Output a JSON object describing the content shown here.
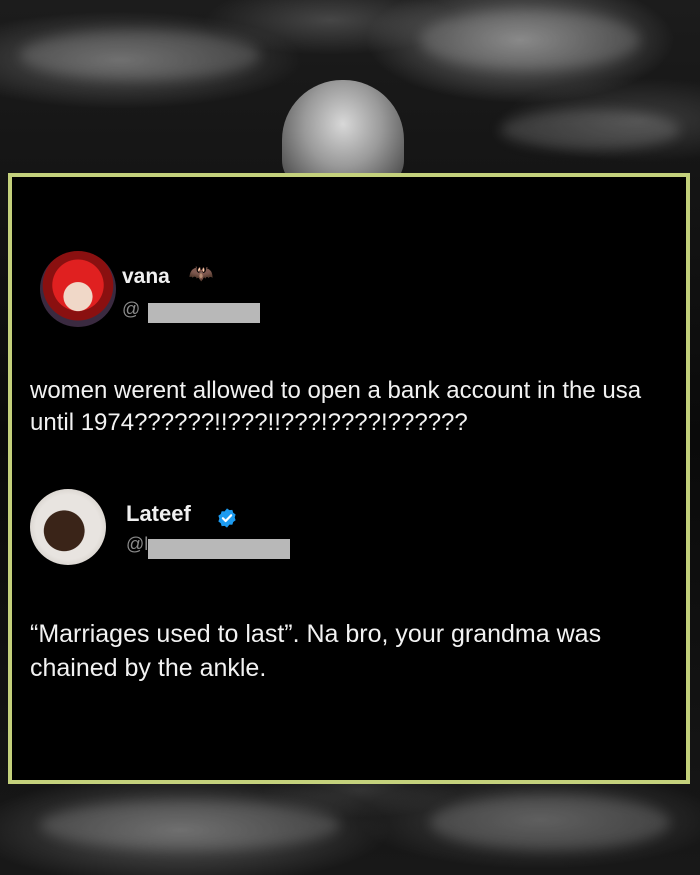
{
  "tweets": [
    {
      "name": "vana",
      "handle_visible": "@",
      "text": "women werent allowed to open a bank account in the usa until 1974??????!!???!!???!????!??????",
      "verified": false,
      "emoji_icon": "bat-icon"
    },
    {
      "name": "Lateef",
      "handle_visible": "@l",
      "text": "“Marriages used to last”. Na bro, your grandma was chained by the ankle.",
      "verified": true
    }
  ],
  "colors": {
    "card_border": "#c4d17c",
    "card_background": "#000000",
    "verified": "#1d9bf0"
  }
}
